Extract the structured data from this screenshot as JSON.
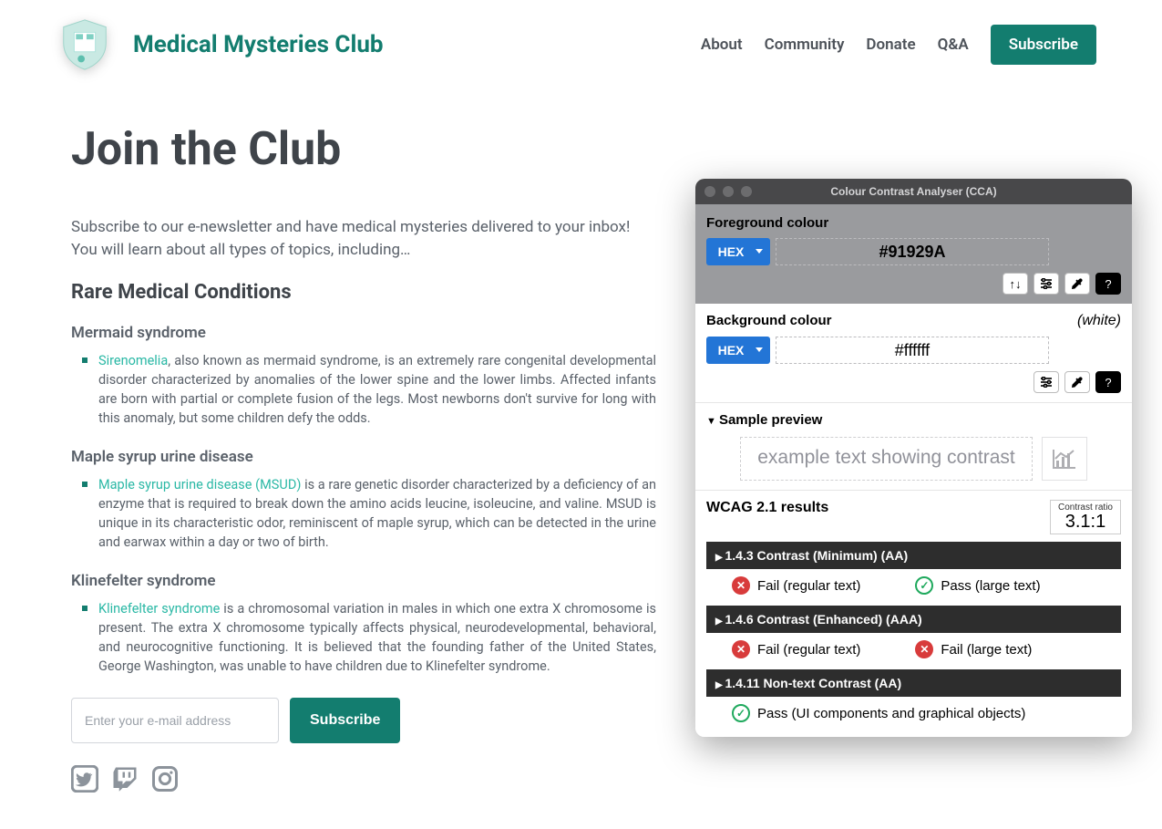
{
  "header": {
    "brand_title": "Medical Mysteries Club",
    "nav": {
      "about": "About",
      "community": "Community",
      "donate": "Donate",
      "qa": "Q&A",
      "subscribe": "Subscribe"
    }
  },
  "page": {
    "title": "Join the Club",
    "intro": "Subscribe to our e-newsletter and have medical mysteries delivered to your inbox! You will learn about all types of topics, including…",
    "section_heading": "Rare Medical Conditions"
  },
  "conditions": {
    "mermaid": {
      "heading": "Mermaid syndrome",
      "link_text": "Sirenomelia",
      "body": ", also known as mermaid syndrome, is an extremely rare congenital developmental disorder characterized by anomalies of the lower spine and the lower limbs. Affected infants are born with partial or complete fusion of the legs. Most newborns don't survive for long with this anomaly, but some children defy the odds."
    },
    "msud": {
      "heading": "Maple syrup urine disease",
      "link_text": "Maple syrup urine disease (MSUD)",
      "body": " is a rare genetic disorder characterized by a deficiency of an enzyme that is required to break down the amino acids leucine, isoleucine, and valine. MSUD is unique in its characteristic odor, reminiscent of maple syrup, which can be detected in the urine and earwax within a day or two of birth."
    },
    "klinefelter": {
      "heading": "Klinefelter syndrome",
      "link_text": "Klinefelter syndrome",
      "body": " is a chromosomal variation in males in which one extra X chromosome is present. The extra X chromosome typically affects physical, neurodevelopmental, behavioral, and neurocognitive functioning. It is believed that the founding father of the United States, George Washington, was unable to have children due to Klinefelter syndrome."
    }
  },
  "form": {
    "placeholder": "Enter your e-mail address",
    "button": "Subscribe"
  },
  "cca": {
    "title": "Colour Contrast Analyser (CCA)",
    "fg_label": "Foreground colour",
    "fg_format": "HEX",
    "fg_value": "#91929A",
    "bg_label": "Background colour",
    "bg_note": "(white)",
    "bg_format": "HEX",
    "bg_value": "#ffffff",
    "sample_label": "Sample preview",
    "sample_text": "example text showing contrast",
    "results_label": "WCAG 2.1 results",
    "ratio_label": "Contrast ratio",
    "ratio_value": "3.1:1",
    "r1": {
      "title": "1.4.3 Contrast (Minimum) (AA)",
      "a": "Fail (regular text)",
      "b": "Pass (large text)"
    },
    "r2": {
      "title": "1.4.6 Contrast (Enhanced) (AAA)",
      "a": "Fail (regular text)",
      "b": "Fail (large text)"
    },
    "r3": {
      "title": "1.4.11 Non-text Contrast (AA)",
      "a": "Pass (UI components and graphical objects)"
    }
  }
}
